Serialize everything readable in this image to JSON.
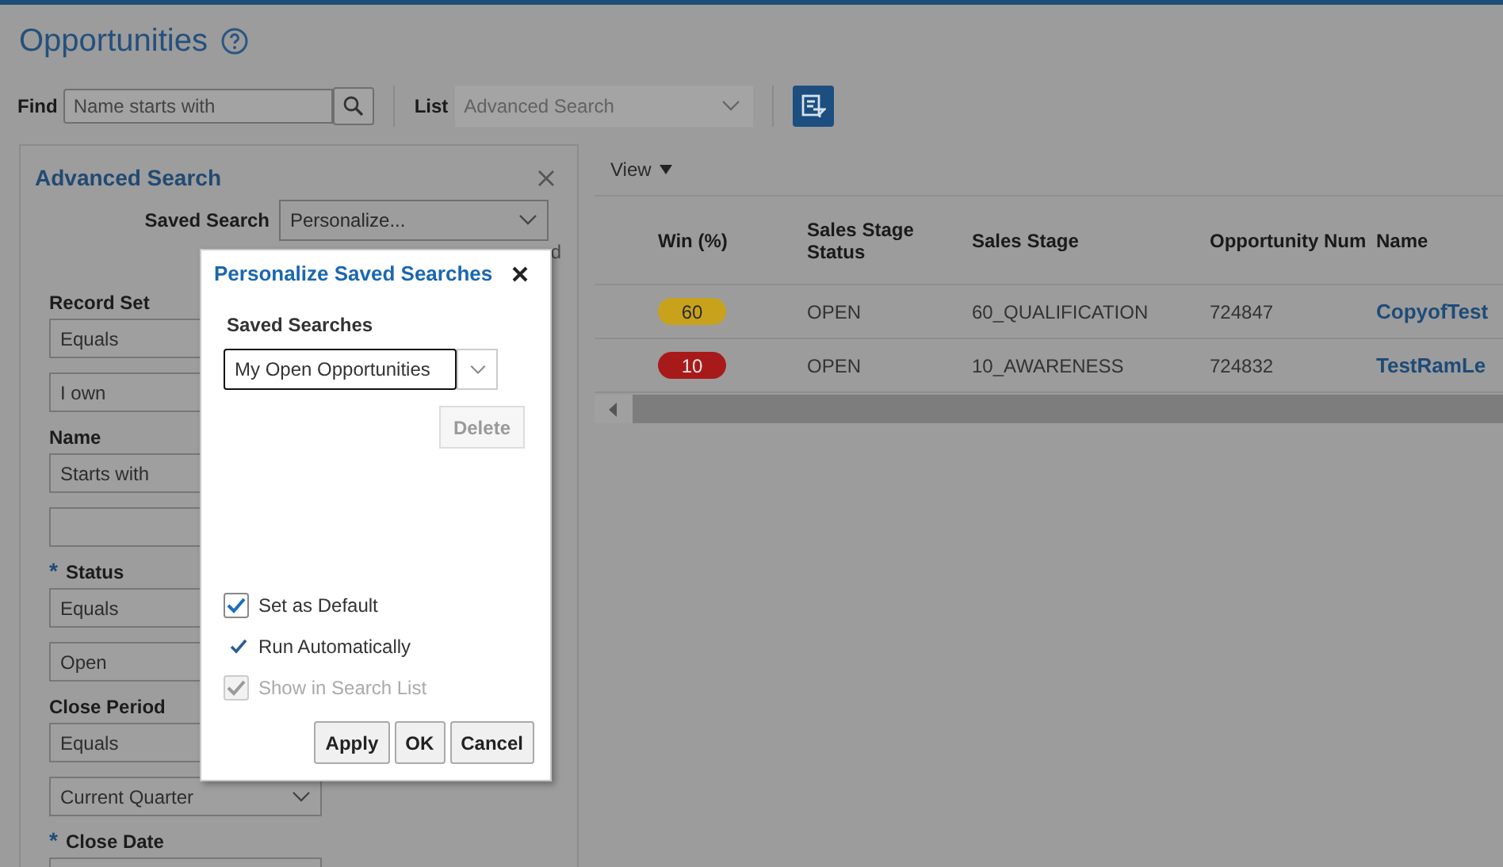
{
  "page": {
    "title": "Opportunities"
  },
  "find": {
    "label": "Find",
    "placeholder": "Name starts with"
  },
  "list": {
    "label": "List",
    "value": "Advanced Search",
    "disabled": true
  },
  "advanced_search": {
    "title": "Advanced Search",
    "saved_search": {
      "label": "Saved Search",
      "value": "Personalize..."
    },
    "hidden_fragment": "d",
    "fields": [
      {
        "label": "Record Set",
        "inputs": [
          {
            "kind": "text",
            "value": "Equals"
          },
          {
            "kind": "text",
            "value": "I own"
          }
        ]
      },
      {
        "label": "Name",
        "inputs": [
          {
            "kind": "text",
            "value": "Starts with"
          },
          {
            "kind": "text"
          }
        ]
      },
      {
        "marker": "*",
        "label": "Status",
        "inputs": [
          {
            "kind": "text",
            "value": "Equals"
          },
          {
            "kind": "text",
            "value": "Open"
          }
        ]
      },
      {
        "label": "Close Period",
        "inputs": [
          {
            "kind": "text",
            "value": "Equals"
          },
          {
            "kind": "select",
            "value": "Current Quarter"
          }
        ]
      },
      {
        "marker": "*",
        "label": "Close Date",
        "inputs": [
          {
            "kind": "text"
          }
        ]
      }
    ]
  },
  "table": {
    "view_menu": "View",
    "columns": [
      "Win (%)",
      "Sales Stage Status",
      "Sales Stage",
      "Opportunity Num",
      "Name"
    ],
    "rows": [
      {
        "color": "#c9a21c",
        "cells": [
          "60",
          "OPEN",
          "60_QUALIFICATION",
          "724847",
          "CopyofTest"
        ]
      },
      {
        "color": "#a81a1a",
        "cells": [
          "10",
          "OPEN",
          "10_AWARENESS",
          "724832",
          "TestRamLe"
        ]
      }
    ]
  },
  "dialog": {
    "title": "Personalize Saved Searches",
    "saved_searches_label": "Saved Searches",
    "selected_search": "My Open Opportunities",
    "delete": {
      "label": "Delete",
      "disabled": true
    },
    "options": [
      {
        "kind": "checkbox",
        "label": "Set as Default",
        "checked": true,
        "disabled": false
      },
      {
        "kind": "tick",
        "label": "Run Automatically",
        "checked": true,
        "disabled": false
      },
      {
        "kind": "checkbox",
        "label": "Show in Search List",
        "checked": true,
        "disabled": true
      }
    ],
    "buttons": [
      "Apply",
      "OK",
      "Cancel"
    ]
  }
}
